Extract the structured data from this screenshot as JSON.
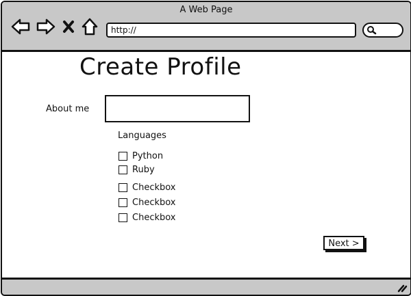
{
  "window": {
    "title": "A Web Page"
  },
  "toolbar": {
    "back_icon": "back-arrow-icon",
    "forward_icon": "forward-arrow-icon",
    "stop_icon": "close-icon",
    "home_icon": "home-icon",
    "url": "http://",
    "search_icon": "search-icon"
  },
  "page": {
    "title": "Create Profile",
    "about_label": "About me",
    "about_value": "",
    "languages_label": "Languages",
    "checkboxes": [
      {
        "label": "Python",
        "checked": false
      },
      {
        "label": "Ruby",
        "checked": false
      },
      {
        "label": "Checkbox",
        "checked": false
      },
      {
        "label": "Checkbox",
        "checked": false
      },
      {
        "label": "Checkbox",
        "checked": false
      }
    ],
    "next_label": "Next >"
  },
  "colors": {
    "chrome": "#c8c8c8",
    "ink": "#111111",
    "background": "#ffffff"
  }
}
